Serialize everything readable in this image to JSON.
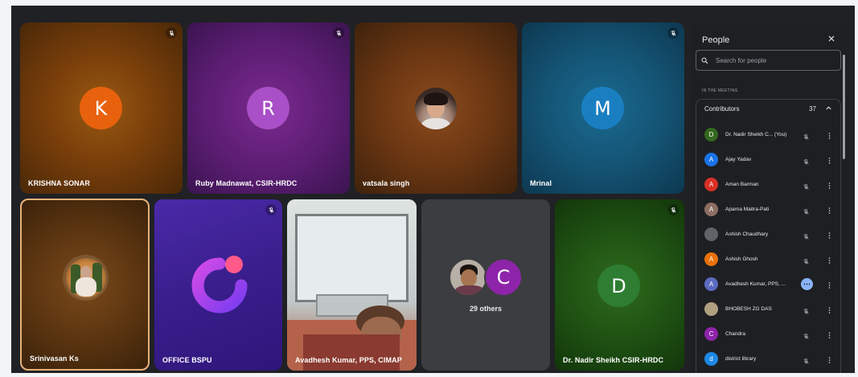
{
  "tiles": [
    {
      "name": "KRISHNA SONAR",
      "initial": "K"
    },
    {
      "name": "Ruby Madnawat, CSIR-HRDC",
      "initial": "R"
    },
    {
      "name": "vatsala singh"
    },
    {
      "name": "Mrinal",
      "initial": "M"
    },
    {
      "name": "Srinivasan Ks"
    },
    {
      "name": "OFFICE BSPU"
    },
    {
      "name": "Avadhesh Kumar, PPS, CIMAP"
    },
    {
      "name": "29 others",
      "initial": "C"
    },
    {
      "name": "Dr. Nadir Sheikh CSIR-HRDC",
      "initial": "D"
    }
  ],
  "panel": {
    "title": "People",
    "search_placeholder": "Search for people",
    "section_label": "IN THE MEETING",
    "group_label": "Contributors",
    "group_count": "37",
    "people": [
      {
        "initial": "D",
        "name": "Dr. Nadir Sheikh C... (You)",
        "color": "#33691e"
      },
      {
        "initial": "A",
        "name": "Ajay Yadav",
        "color": "#1a73e8"
      },
      {
        "initial": "A",
        "name": "Aman Barman",
        "color": "#d93025"
      },
      {
        "initial": "A",
        "name": "Aparna Maitra-Pati",
        "color": "#8d6e63"
      },
      {
        "initial": "",
        "name": "Ashish Chaudhary",
        "color": "#5f6368"
      },
      {
        "initial": "A",
        "name": "Ashish Ghosh",
        "color": "#e8710a"
      },
      {
        "initial": "A",
        "name": "Avadhesh Kumar, PPS, ...",
        "color": "#5c6bc0"
      },
      {
        "initial": "",
        "name": "BHOBESH ZG DAS",
        "color": "#b0a080"
      },
      {
        "initial": "C",
        "name": "Chandra",
        "color": "#8e24aa"
      },
      {
        "initial": "d",
        "name": "district library",
        "color": "#1e88e5"
      }
    ]
  },
  "colors": {
    "k": "#e8620e",
    "r": "#a94fc7",
    "m": "#1a7fc1",
    "c": "#8e24aa",
    "d": "#2e7d32"
  }
}
